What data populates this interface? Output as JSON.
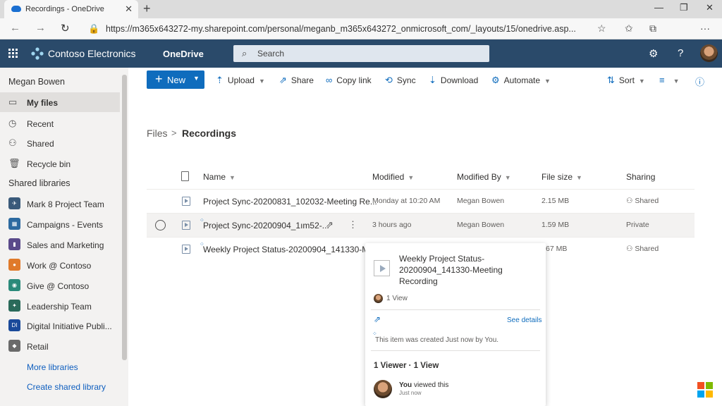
{
  "browser": {
    "tab_title": "Recordings - OneDrive",
    "tab_close": "✕",
    "new_tab": "+",
    "url": "https://m365x643272-my.sharepoint.com/personal/meganb_m365x643272_onmicrosoft_com/_layouts/15/onedrive.asp...",
    "window_controls": {
      "minimize": "—",
      "restore": "❐",
      "close": "✕"
    },
    "nav": {
      "back": "←",
      "forward": "→",
      "refresh": "↻",
      "lock": "🔒",
      "more": "···"
    }
  },
  "suitebar": {
    "brand": "Contoso Electronics",
    "app": "OneDrive",
    "search_placeholder": "Search",
    "settings_glyph": "⚙",
    "help_glyph": "?"
  },
  "leftnav": {
    "user": "Megan Bowen",
    "items": [
      {
        "label": "My files",
        "icon": "▭"
      },
      {
        "label": "Recent",
        "icon": "◷"
      },
      {
        "label": "Shared",
        "icon": "⚇"
      },
      {
        "label": "Recycle bin",
        "icon": "🗑"
      }
    ],
    "libraries_heading": "Shared libraries",
    "libraries": [
      {
        "label": "Mark 8 Project Team",
        "color": "#3a5a7a"
      },
      {
        "label": "Campaigns - Events",
        "color": "#2d6aa0"
      },
      {
        "label": "Sales and Marketing",
        "color": "#5a4a8a"
      },
      {
        "label": "Work @ Contoso",
        "color": "#e07a2a"
      },
      {
        "label": "Give @ Contoso",
        "color": "#2a8a7a"
      },
      {
        "label": "Leadership Team",
        "color": "#2a6a5a"
      },
      {
        "label": "Digital Initiative Publi...",
        "color": "#1a4a9a",
        "badge": "DI"
      },
      {
        "label": "Retail",
        "color": "#6a6a6a"
      }
    ],
    "more_libraries": "More libraries",
    "create_library": "Create shared library"
  },
  "commandbar": {
    "new": "New",
    "upload": "Upload",
    "share": "Share",
    "copy_link": "Copy link",
    "sync": "Sync",
    "download": "Download",
    "automate": "Automate",
    "sort": "Sort"
  },
  "breadcrumb": {
    "root": "Files",
    "sep": ">",
    "current": "Recordings"
  },
  "columns": {
    "name": "Name",
    "modified": "Modified",
    "modified_by": "Modified By",
    "file_size": "File size",
    "sharing": "Sharing"
  },
  "files": [
    {
      "name": "Project Sync-20200831_102032-Meeting Re...",
      "modified": "Monday at 10:20 AM",
      "modified_by": "Megan Bowen",
      "size": "2.15 MB",
      "sharing": "Shared"
    },
    {
      "name": "Project Sync-20200904_1ım52-...",
      "modified": "3 hours ago",
      "modified_by": "Megan Bowen",
      "size": "1.59 MB",
      "sharing": "Private"
    },
    {
      "name": "Weekly Project Status-20200904_141330-M...",
      "modified": "",
      "modified_by": "",
      "size": "67 MB",
      "sharing": "Shared"
    }
  ],
  "card": {
    "title": "Weekly Project Status-20200904_141330-Meeting Recording",
    "views": "1 View",
    "see_details": "See details",
    "created": "This item was created Just now by You.",
    "viewer_summary": "1 Viewer · 1 View",
    "activity_user": "You",
    "activity_text": "viewed this",
    "activity_time": "Just now"
  },
  "colors": {
    "suitebar": "#2a4a6a",
    "accent": "#0f6cbd"
  }
}
